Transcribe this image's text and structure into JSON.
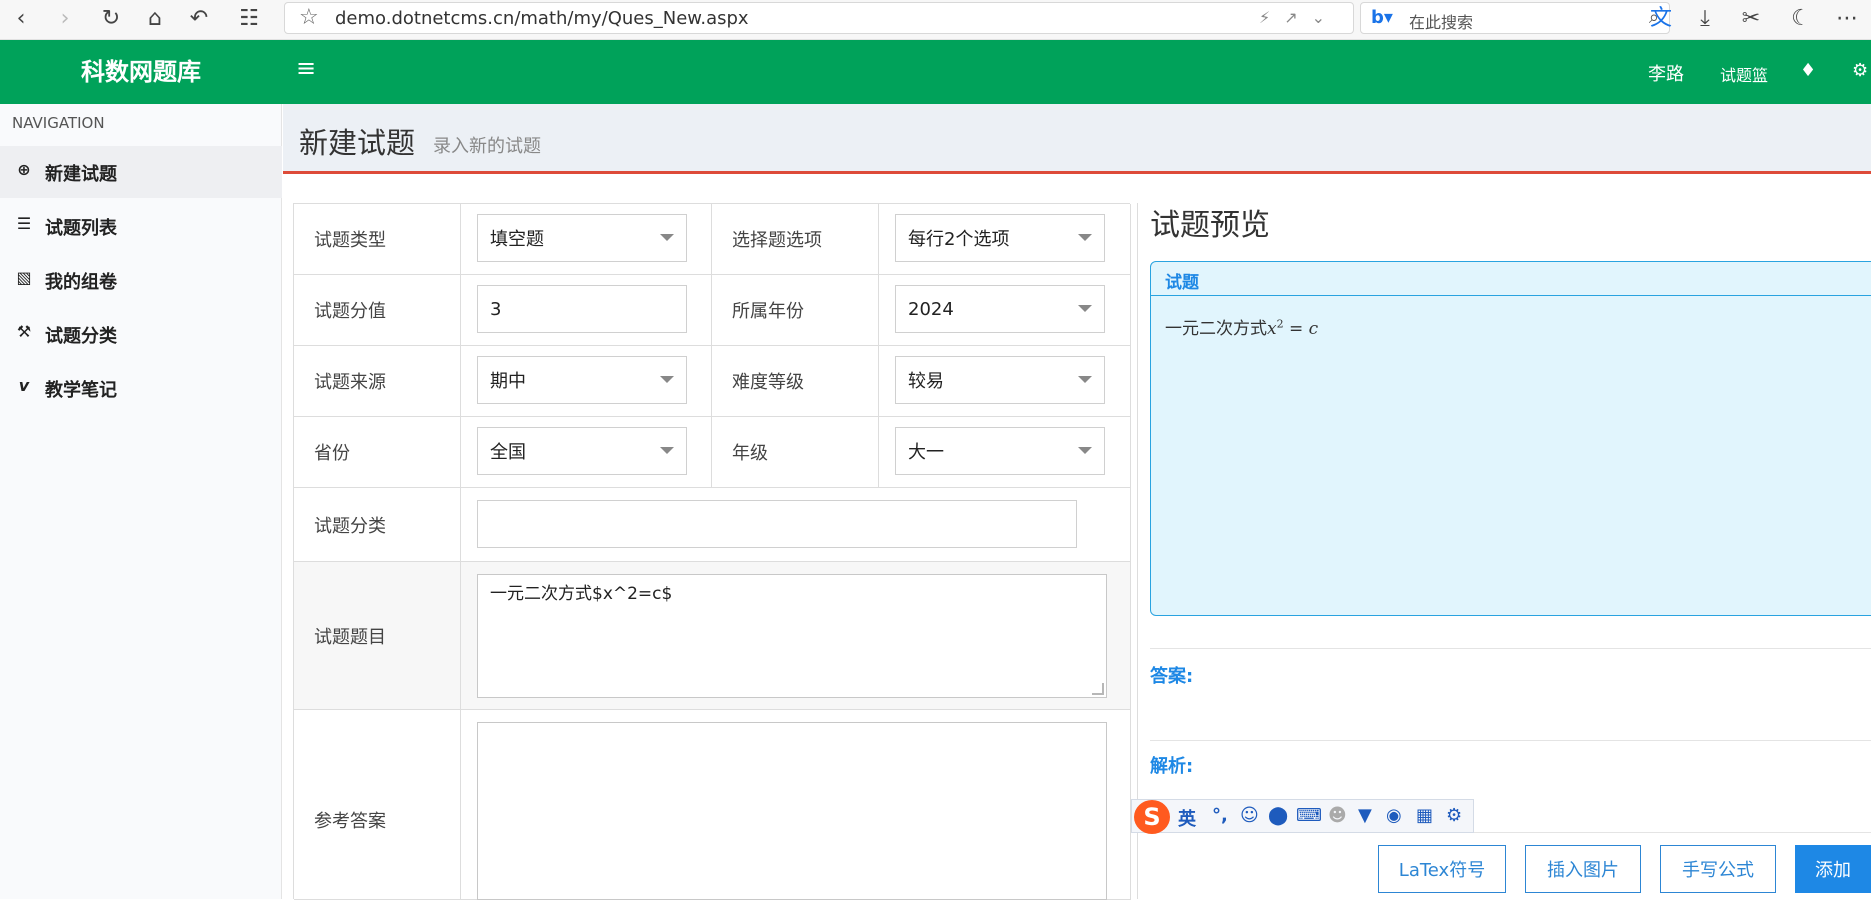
{
  "browser": {
    "url": "demo.dotnetcms.cn/math/my/Ques_New.aspx",
    "search_placeholder": "在此搜索"
  },
  "topnav": {
    "brand": "科数网题库",
    "user": "李路",
    "basket": "试题篮",
    "color": "#00a25a"
  },
  "sidebar": {
    "header": "NAVIGATION",
    "items": [
      {
        "label": "新建试题",
        "icon": "plus-circle-icon"
      },
      {
        "label": "试题列表",
        "icon": "list-icon"
      },
      {
        "label": "我的组卷",
        "icon": "map-icon"
      },
      {
        "label": "试题分类",
        "icon": "wrench-icon"
      },
      {
        "label": "教学笔记",
        "icon": "vimeo-icon"
      }
    ]
  },
  "page": {
    "title": "新建试题",
    "subtitle": "录入新的试题"
  },
  "form": {
    "type_label": "试题类型",
    "type_value": "填空题",
    "choice_label": "选择题选项",
    "choice_value": "每行2个选项",
    "score_label": "试题分值",
    "score_value": "3",
    "year_label": "所属年份",
    "year_value": "2024",
    "source_label": "试题来源",
    "source_value": "期中",
    "difficulty_label": "难度等级",
    "difficulty_value": "较易",
    "province_label": "省份",
    "province_value": "全国",
    "grade_label": "年级",
    "grade_value": "大一",
    "category_label": "试题分类",
    "category_value": "",
    "question_label": "试题题目",
    "question_value": "一元二次方式$x^2=c$",
    "answer_label": "参考答案",
    "answer_value": ""
  },
  "preview": {
    "title": "试题预览",
    "question_head": "试题",
    "question_text_prefix": "一元二次方式",
    "answer_label": "答案:",
    "analysis_label": "解析:"
  },
  "ime": {
    "logo": "S",
    "lang": "英"
  },
  "buttons": {
    "latex": "LaTex符号",
    "insert_image": "插入图片",
    "handwrite": "手写公式",
    "add": "添加"
  }
}
